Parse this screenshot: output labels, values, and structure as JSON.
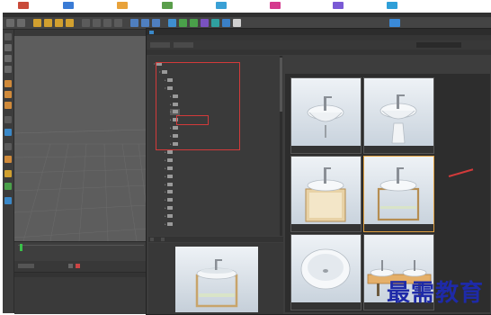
{
  "app": {
    "menu_items": [
      "",
      "",
      "",
      "",
      "",
      "",
      "",
      "",
      "",
      "",
      "",
      "",
      "",
      "",
      "",
      "",
      "",
      "",
      "",
      "",
      ""
    ],
    "viewport_label": "",
    "timeline": {
      "frame_start": "",
      "frame_end": ""
    }
  },
  "browser": {
    "title": "",
    "tree": [
      {
        "label": "",
        "depth": 0,
        "expanded": true
      },
      {
        "label": "",
        "depth": 1,
        "expanded": true
      },
      {
        "label": "",
        "depth": 2,
        "expanded": false
      },
      {
        "label": "",
        "depth": 2,
        "expanded": true
      },
      {
        "label": "",
        "depth": 3,
        "expanded": false
      },
      {
        "label": "",
        "depth": 3,
        "expanded": false
      },
      {
        "label": "",
        "depth": 3,
        "expanded": false,
        "selected": true
      },
      {
        "label": "",
        "depth": 3,
        "expanded": false
      },
      {
        "label": "",
        "depth": 3,
        "expanded": false
      },
      {
        "label": "",
        "depth": 3,
        "expanded": false
      },
      {
        "label": "",
        "depth": 3,
        "expanded": false
      },
      {
        "label": "",
        "depth": 2,
        "expanded": false
      },
      {
        "label": "",
        "depth": 2,
        "expanded": false
      },
      {
        "label": "",
        "depth": 2,
        "expanded": false
      },
      {
        "label": "",
        "depth": 2,
        "expanded": false
      },
      {
        "label": "",
        "depth": 2,
        "expanded": false
      },
      {
        "label": "",
        "depth": 2,
        "expanded": false
      },
      {
        "label": "",
        "depth": 2,
        "expanded": false
      },
      {
        "label": "",
        "depth": 2,
        "expanded": false
      },
      {
        "label": "",
        "depth": 2,
        "expanded": false
      },
      {
        "label": "",
        "depth": 2,
        "expanded": false
      }
    ],
    "thumbnails": [
      {
        "kind": "wall-sink",
        "caption": "",
        "selected": false
      },
      {
        "kind": "pedestal-sink",
        "caption": "",
        "selected": false
      },
      {
        "kind": "vessel-cabinet",
        "caption": "",
        "selected": false
      },
      {
        "kind": "vessel-stand",
        "caption": "",
        "selected": true
      },
      {
        "kind": "bowl-sink",
        "caption": "",
        "selected": false
      },
      {
        "kind": "double-sink",
        "caption": "",
        "selected": false
      }
    ]
  },
  "watermark": "最需教育",
  "colors": {
    "annotation_red": "#d23a3a",
    "watermark_blue": "#1e2aa8",
    "selection_orange": "#e0a040"
  }
}
